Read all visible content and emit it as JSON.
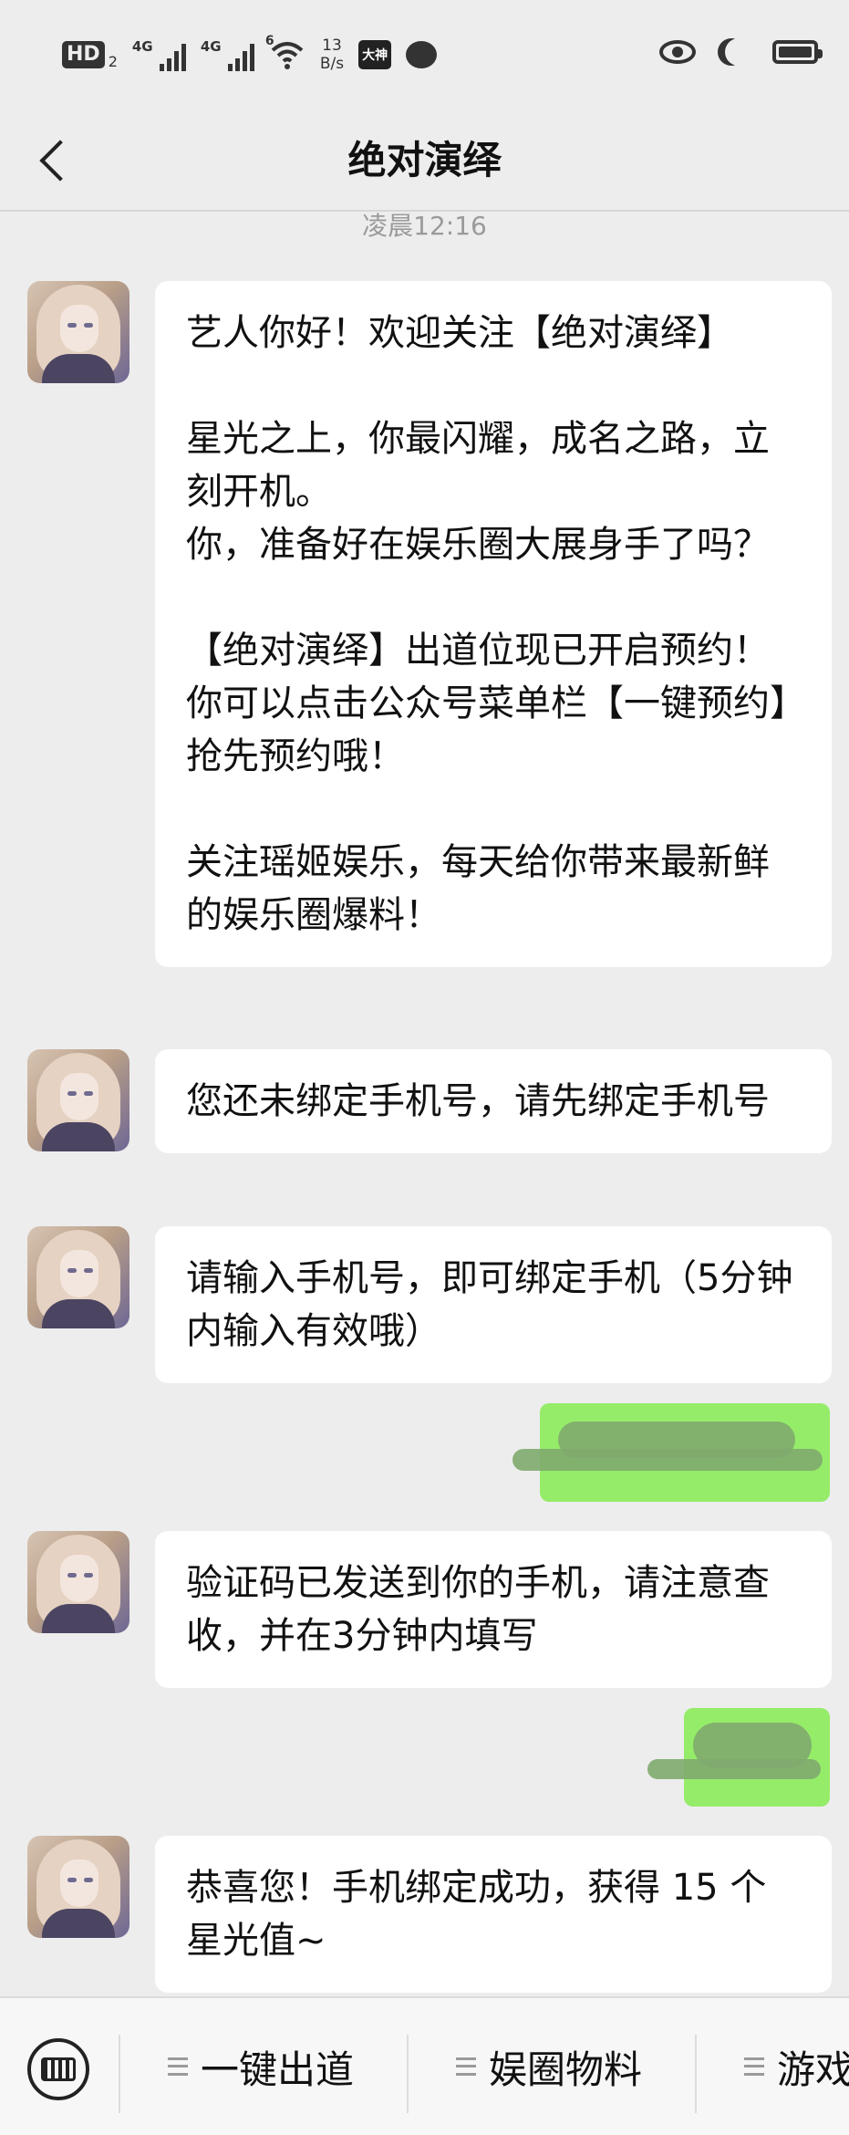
{
  "status_bar": {
    "hd": "HD",
    "hd_sub": "2",
    "net1": "4G",
    "net2": "4G",
    "wifi": "6",
    "speed_value": "13",
    "speed_unit": "B/s",
    "app_badge": "大神"
  },
  "header": {
    "title": "绝对演绎"
  },
  "timestamp": "凌晨12:16",
  "messages": [
    {
      "paragraphs": [
        "艺人你好！欢迎关注【绝对演绎】",
        "星光之上，你最闪耀，成名之路，立刻开机。\n你，准备好在娱乐圈大展身手了吗？",
        "【绝对演绎】出道位现已开启预约！你可以点击公众号菜单栏【一键预约】抢先预约哦！",
        "关注瑶姬娱乐，每天给你带来最新鲜的娱乐圈爆料！"
      ]
    },
    {
      "text": "您还未绑定手机号，请先绑定手机号"
    },
    {
      "text": "请输入手机号，即可绑定手机（5分钟内输入有效哦）"
    },
    {
      "text": "验证码已发送到你的手机，请注意查收，并在3分钟内填写"
    },
    {
      "text": "恭喜您！手机绑定成功，获得 15 个星光值~"
    }
  ],
  "menu": {
    "items": [
      "一键出道",
      "娱圈物料",
      "游戏"
    ]
  },
  "colors": {
    "background": "#ededed",
    "bubble_incoming": "#ffffff",
    "bubble_outgoing": "#95ec69"
  },
  "icons": [
    "back-arrow-icon",
    "keyboard-icon",
    "menu-list-icon",
    "eye-icon",
    "moon-icon",
    "battery-icon",
    "wifi-icon",
    "signal-icon",
    "chat-icon"
  ]
}
